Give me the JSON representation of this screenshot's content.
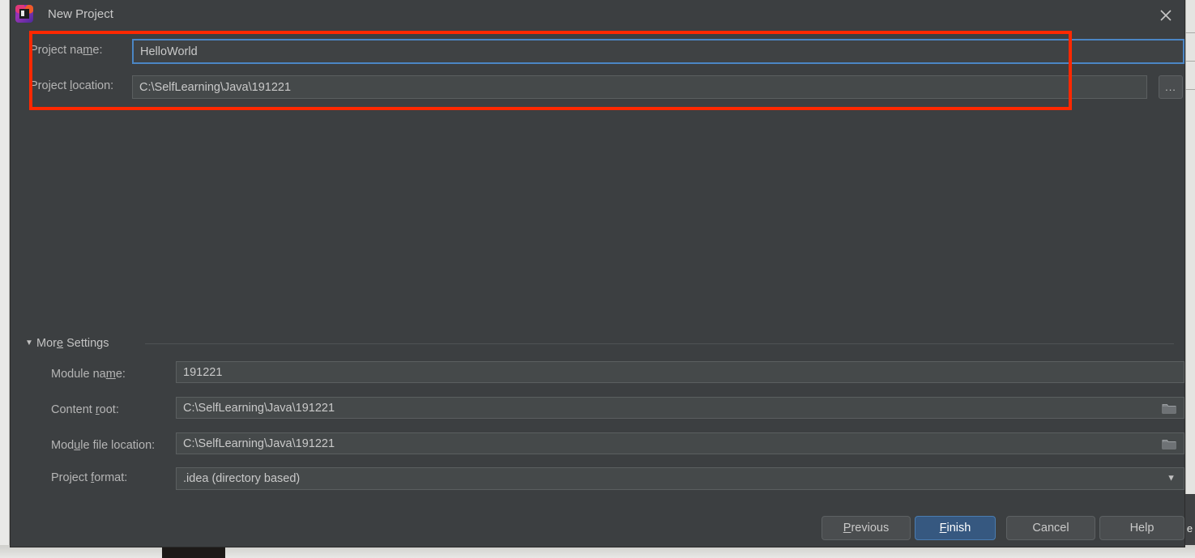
{
  "window": {
    "title": "New Project",
    "app_icon": "intellij-idea-icon",
    "close_icon": "close-icon"
  },
  "top_fields": {
    "project_name": {
      "label_pre": "P",
      "label_mid": "roject na",
      "label_mn": "m",
      "label_post": "e:",
      "value": "HelloWorld",
      "focused": true
    },
    "project_location": {
      "label_pre": "P",
      "label_mid": "roject ",
      "label_mn": "l",
      "label_post": "ocation:",
      "value": "C:\\SelfLearning\\Java\\191221",
      "browse_label": "..."
    }
  },
  "annotation": {
    "shape": "rectangle",
    "color": "#ff2800",
    "target": "project-name-and-location-fields"
  },
  "more_settings": {
    "arrow": "triangle-down-icon",
    "label_pre": "Mor",
    "label_mn": "e",
    "label_post": " Settings",
    "expanded": true,
    "fields": {
      "module_name": {
        "label_pre": "Module na",
        "label_mn": "m",
        "label_post": "e:",
        "value": "191221"
      },
      "content_root": {
        "label_pre": "Content ",
        "label_mn": "r",
        "label_post": "oot:",
        "value": "C:\\SelfLearning\\Java\\191221",
        "trailing_icon": "folder-icon"
      },
      "module_file_location": {
        "label_pre": "Mod",
        "label_mn": "u",
        "label_post": "le file location:",
        "value": "C:\\SelfLearning\\Java\\191221",
        "trailing_icon": "folder-icon"
      },
      "project_format": {
        "label_pre": "Project ",
        "label_mn": "f",
        "label_post": "ormat:",
        "value": ".idea (directory based)",
        "arrow": "chevron-down-icon"
      }
    }
  },
  "buttons": {
    "previous": {
      "pre": "",
      "mn": "P",
      "post": "revious"
    },
    "finish": {
      "pre": "",
      "mn": "F",
      "post": "inish",
      "primary": true,
      "color": "#365880"
    },
    "cancel": {
      "pre": "Cancel",
      "mn": "",
      "post": ""
    },
    "help": {
      "pre": "Help",
      "mn": "",
      "post": ""
    }
  },
  "background": {
    "right_glyph": "e"
  }
}
